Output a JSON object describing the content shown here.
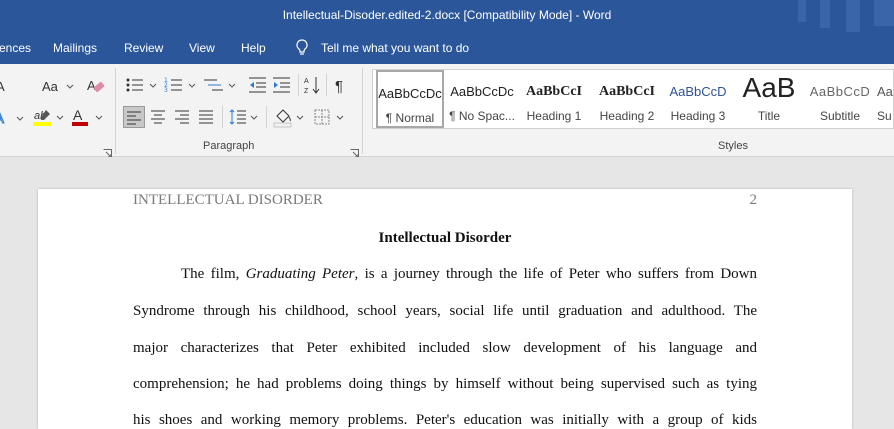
{
  "title": "Intellectual-Disoder.edited-2.docx [Compatibility Mode]  -  Word",
  "tabs": [
    "ences",
    "Mailings",
    "Review",
    "View",
    "Help"
  ],
  "tell_me": "Tell me what you want to do",
  "ribbon": {
    "font_group": {
      "change_case_label": "Aa"
    },
    "paragraph_label": "Paragraph",
    "styles_label": "Styles",
    "styles": [
      {
        "preview": "AaBbCcDc",
        "label": "¶ Normal"
      },
      {
        "preview": "AaBbCcDc",
        "label": "¶ No Spac..."
      },
      {
        "preview": "AaBbCcI",
        "label": "Heading 1"
      },
      {
        "preview": "AaBbCcI",
        "label": "Heading 2"
      },
      {
        "preview": "AaBbCcD",
        "label": "Heading 3"
      },
      {
        "preview": "AaB",
        "label": "Title"
      },
      {
        "preview": "AaBbCcD",
        "label": "Subtitle"
      },
      {
        "preview": "Aa",
        "label": "Su"
      }
    ]
  },
  "colors": {
    "brand": "#2b579a",
    "highlight": "#ffff00",
    "font_color": "#c00000"
  },
  "document": {
    "header": "INTELLECTUAL DISORDER",
    "page_number": "2",
    "title": "Intellectual Disorder",
    "p1": {
      "before": "The film, ",
      "italic": "Graduating Peter",
      "after": ", is a journey through the life of Peter who suffers from Down"
    },
    "lines": [
      "Syndrome through his childhood, school years, social life until graduation and adulthood. The",
      "major characterizes that Peter exhibited included slow development of his language and",
      "comprehension; he had problems doing things by himself without being supervised such as tying",
      "his shoes and working memory problems. Peter's education was initially with a group of kids"
    ]
  }
}
